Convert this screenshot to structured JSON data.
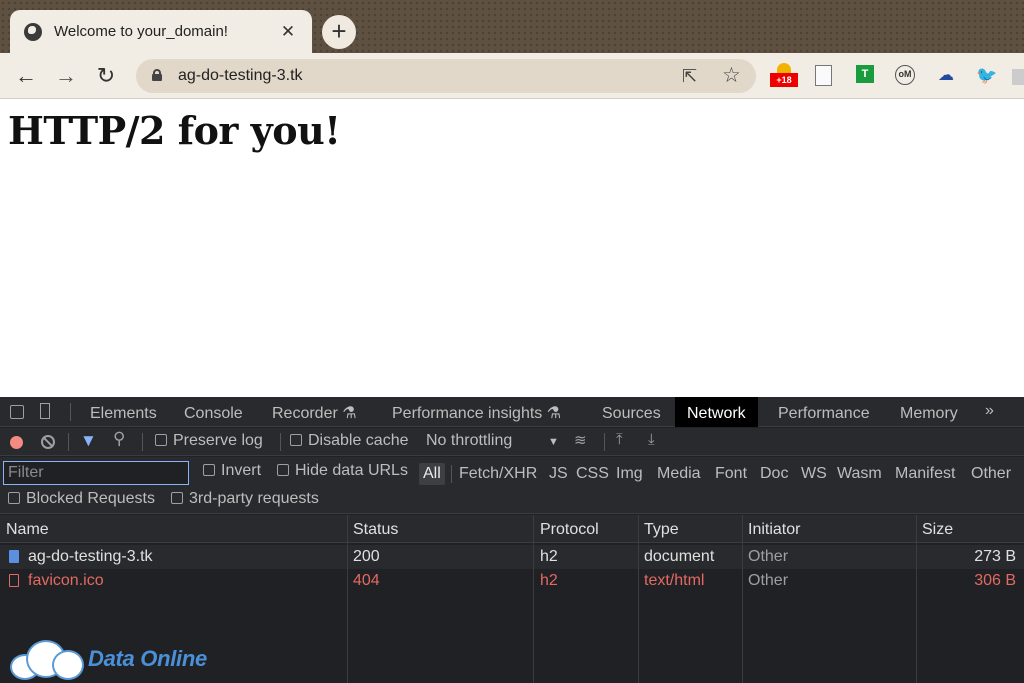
{
  "browser": {
    "tab_title": "Welcome to your_domain!",
    "tab_close": "✕",
    "new_tab": "+",
    "url": "ag-do-testing-3.tk",
    "ext_flag_badge": "+18",
    "ext_t_label": "T",
    "ext_em_label": "oM"
  },
  "page": {
    "heading": "HTTP/2 for you!"
  },
  "devtools": {
    "tabs": [
      {
        "label": "Elements"
      },
      {
        "label": "Console"
      },
      {
        "label": "Recorder ⚗"
      },
      {
        "label": "Performance insights ⚗"
      },
      {
        "label": "Sources"
      },
      {
        "label": "Network"
      },
      {
        "label": "Performance"
      },
      {
        "label": "Memory"
      }
    ],
    "more_tabs": "»",
    "active_tab": "Network",
    "toolbar": {
      "preserve_log": "Preserve log",
      "disable_cache": "Disable cache",
      "throttling": "No throttling",
      "throttling_arrow": "▼"
    },
    "filter": {
      "placeholder": "Filter",
      "invert": "Invert",
      "hide_data_urls": "Hide data URLs",
      "types": [
        "All",
        "Fetch/XHR",
        "JS",
        "CSS",
        "Img",
        "Media",
        "Font",
        "Doc",
        "WS",
        "Wasm",
        "Manifest",
        "Other"
      ],
      "blocked_requests": "Blocked Requests",
      "third_party": "3rd-party requests"
    },
    "table": {
      "headers": [
        "Name",
        "Status",
        "Protocol",
        "Type",
        "Initiator",
        "Size"
      ],
      "rows": [
        {
          "name": "ag-do-testing-3.tk",
          "status": "200",
          "protocol": "h2",
          "type": "document",
          "initiator": "Other",
          "size": "273 B"
        },
        {
          "name": "favicon.ico",
          "status": "404",
          "protocol": "h2",
          "type": "text/html",
          "initiator": "Other",
          "size": "306 B"
        }
      ]
    }
  },
  "watermark": {
    "text": "Data Online"
  },
  "colors": {
    "error": "#e46962",
    "accent": "#8ab4f8",
    "devtools_bg": "#202124"
  }
}
